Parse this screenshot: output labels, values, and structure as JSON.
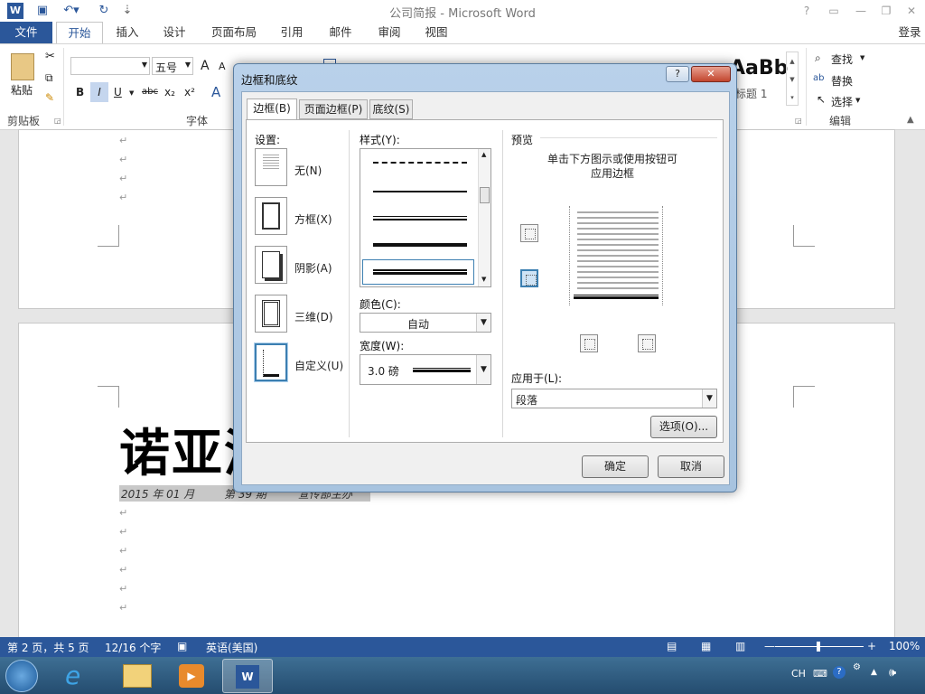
{
  "titlebar": {
    "title": "公司简报 - Microsoft Word",
    "help": "?"
  },
  "tabs": {
    "file": "文件",
    "home": "开始",
    "insert": "插入",
    "design": "设计",
    "layout": "页面布局",
    "references": "引用",
    "mailings": "邮件",
    "review": "审阅",
    "view": "视图",
    "login": "登录"
  },
  "ribbon": {
    "paste": "粘贴",
    "clipboard": "剪贴板",
    "font": "字体",
    "font_size": "五号",
    "editing": "编辑",
    "find": "查找",
    "replace": "替换",
    "select": "选择",
    "style_preview": "AaBb",
    "style_name": "标题 1",
    "bold": "B",
    "italic": "I",
    "underline": "U",
    "strike": "abc",
    "sub": "x₂",
    "sup": "x²",
    "grow": "A",
    "shrink": "A"
  },
  "document": {
    "title_text": "诺亚洲",
    "subtitle_left": "2015 年 01 月",
    "subtitle_mid": "第 39 期",
    "subtitle_right": "宣传部主办",
    "para_mark": "↵"
  },
  "dialog": {
    "title": "边框和底纹",
    "help": "?",
    "close": "✕",
    "tabs": [
      "边框(B)",
      "页面边框(P)",
      "底纹(S)"
    ],
    "settings_label": "设置:",
    "settings": [
      "无(N)",
      "方框(X)",
      "阴影(A)",
      "三维(D)",
      "自定义(U)"
    ],
    "style_label": "样式(Y):",
    "color_label": "颜色(C):",
    "color_value": "自动",
    "width_label": "宽度(W):",
    "width_value": "3.0 磅",
    "preview_label": "预览",
    "preview_hint": [
      "单击下方图示或使用按钮可",
      "应用边框"
    ],
    "apply_label": "应用于(L):",
    "apply_value": "段落",
    "options_button": "选项(O)...",
    "ok_button": "确定",
    "cancel_button": "取消"
  },
  "status": {
    "page": "第 2 页，共 5 页",
    "words": "12/16 个字",
    "language": "英语(美国)",
    "zoom": "100%"
  },
  "taskbar": {
    "ime": "CH"
  },
  "colors": {
    "accent": "#2b579a",
    "dialog_frame": "#b9d1ea"
  }
}
